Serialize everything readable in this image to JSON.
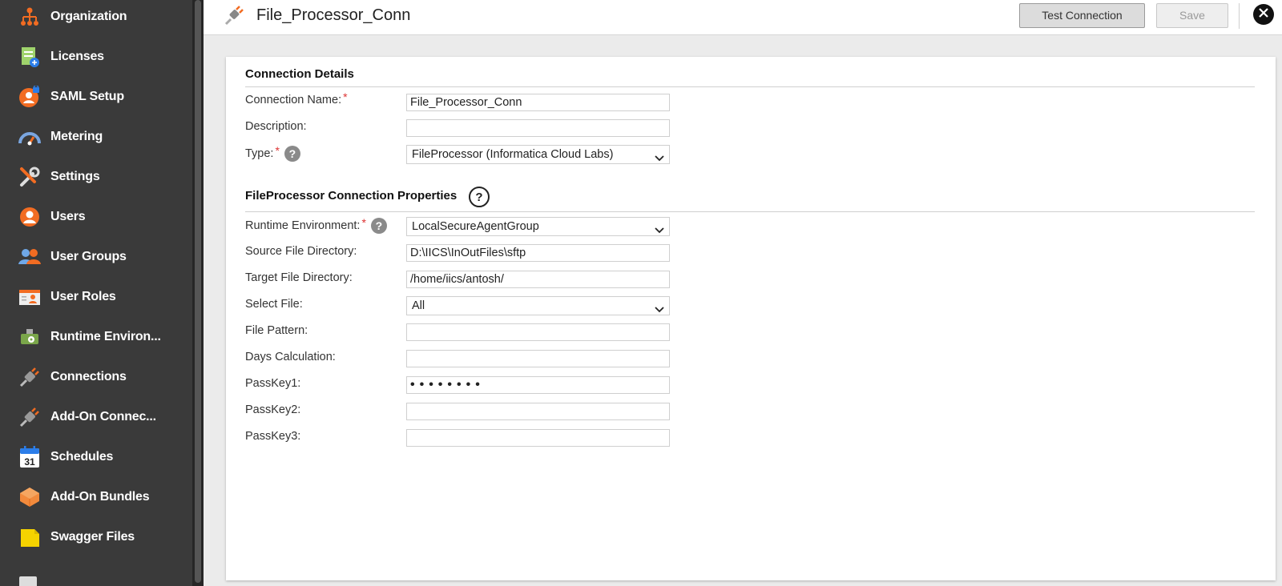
{
  "sidebar": {
    "items": [
      {
        "label": "Organization",
        "icon": "org-chart-icon"
      },
      {
        "label": "Licenses",
        "icon": "license-icon"
      },
      {
        "label": "SAML Setup",
        "icon": "saml-lock-user-icon"
      },
      {
        "label": "Metering",
        "icon": "gauge-icon"
      },
      {
        "label": "Settings",
        "icon": "wrench-screwdriver-icon"
      },
      {
        "label": "Users",
        "icon": "user-icon"
      },
      {
        "label": "User Groups",
        "icon": "user-group-icon"
      },
      {
        "label": "User Roles",
        "icon": "user-role-card-icon"
      },
      {
        "label": "Runtime Environ...",
        "icon": "runtime-gear-icon"
      },
      {
        "label": "Connections",
        "icon": "plug-icon"
      },
      {
        "label": "Add-On Connec...",
        "icon": "addon-plug-icon"
      },
      {
        "label": "Schedules",
        "icon": "calendar-icon"
      },
      {
        "label": "Add-On Bundles",
        "icon": "bundle-box-icon"
      },
      {
        "label": "Swagger Files",
        "icon": "swagger-file-icon"
      }
    ],
    "calendar_day": "31"
  },
  "header": {
    "title": "File_Processor_Conn",
    "test_connection_label": "Test Connection",
    "save_label": "Save"
  },
  "connection_details": {
    "section_title": "Connection Details",
    "name_label": "Connection Name:",
    "name_value": "File_Processor_Conn",
    "description_label": "Description:",
    "description_value": "",
    "type_label": "Type:",
    "type_value": "FileProcessor (Informatica Cloud Labs)"
  },
  "properties": {
    "section_title": "FileProcessor Connection Properties",
    "help_glyph": "?",
    "fields": {
      "runtime_label": "Runtime Environment:",
      "runtime_value": "LocalSecureAgentGroup",
      "source_dir_label": "Source File Directory:",
      "source_dir_value": "D:\\IICS\\InOutFiles\\sftp",
      "target_dir_label": "Target File Directory:",
      "target_dir_value": "/home/iics/antosh/",
      "select_file_label": "Select File:",
      "select_file_value": "All",
      "file_pattern_label": "File Pattern:",
      "file_pattern_value": "",
      "days_calc_label": "Days Calculation:",
      "days_calc_value": "",
      "passkey1_label": "PassKey1:",
      "passkey1_value": "••••••••",
      "passkey2_label": "PassKey2:",
      "passkey2_value": "",
      "passkey3_label": "PassKey3:",
      "passkey3_value": ""
    }
  },
  "required_marker": "*",
  "colors": {
    "sidebar_bg": "#3a3a3a",
    "required": "#dd3333",
    "accent_orange": "#f26c22"
  }
}
